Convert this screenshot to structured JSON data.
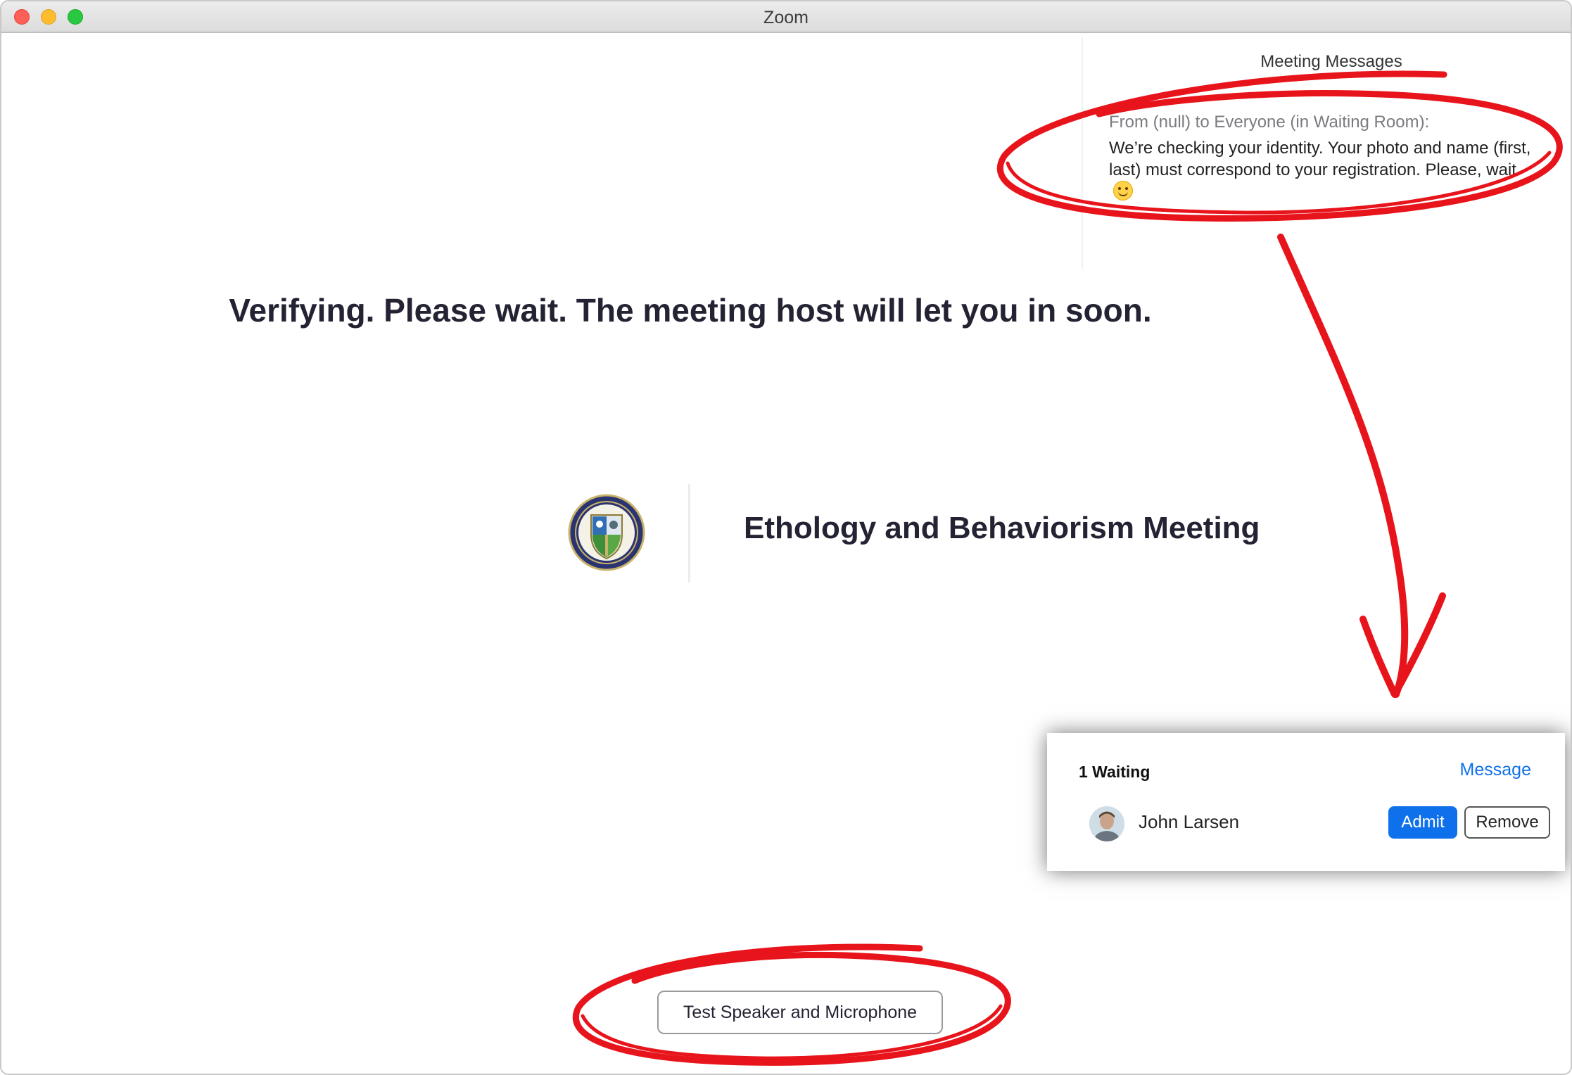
{
  "window": {
    "title": "Zoom"
  },
  "messages": {
    "header": "Meeting Messages",
    "from": "From (null) to Everyone (in Waiting Room):",
    "body": "We’re checking your identity. Your photo and name (first, last) must correspond to your registration. Please, wait.",
    "emoji": "smiling-face-icon"
  },
  "status": {
    "text": "Verifying. Please wait. The meeting host will let you in soon."
  },
  "meeting": {
    "name": "Ethology and Behaviorism Meeting",
    "logo_icon": "institute-seal-icon"
  },
  "waiting": {
    "count_label": "1 Waiting",
    "message_link": "Message",
    "participant_name": "John Larsen",
    "admit_label": "Admit",
    "remove_label": "Remove"
  },
  "bottom": {
    "test_button_label": "Test Speaker and Microphone"
  },
  "colors": {
    "accent": "#0e71eb",
    "annotation": "#e8141b",
    "text_dark": "#232333"
  }
}
